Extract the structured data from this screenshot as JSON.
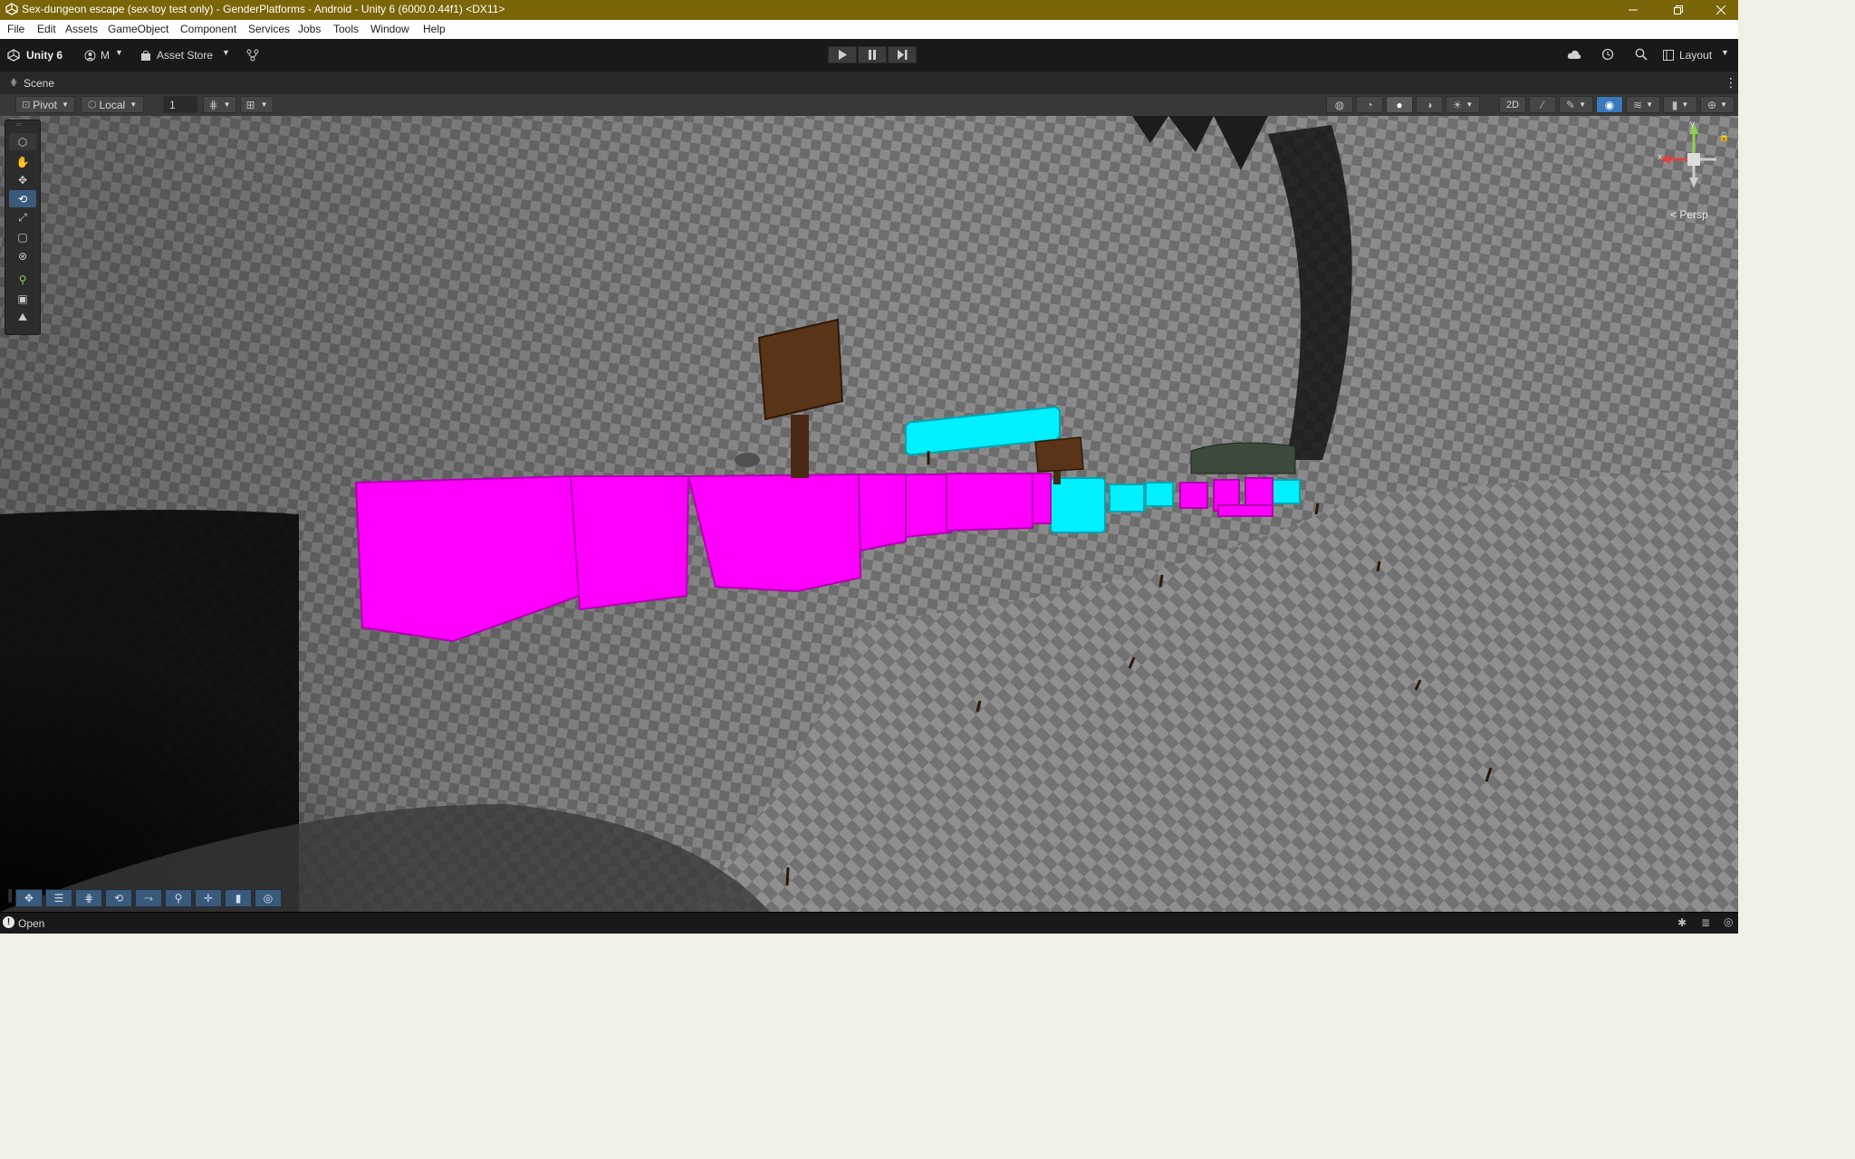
{
  "window": {
    "title": "Sex-dungeon escape (sex-toy test only) - GenderPlatforms - Android - Unity 6 (6000.0.44f1) <DX11>",
    "titlebar_color": "#7b6509",
    "controls": {
      "minimize": "minimize-icon",
      "maximize": "restore-icon",
      "close": "close-icon"
    }
  },
  "menu": [
    "File",
    "Edit",
    "Assets",
    "GameObject",
    "Component",
    "Services",
    "Jobs",
    "Tools",
    "Window",
    "Help"
  ],
  "toolbar": {
    "unity_label": "Unity 6",
    "account_label": "M",
    "asset_store_label": "Asset Store",
    "layout_label": "Layout",
    "play_icons": [
      "play-icon",
      "pause-icon",
      "step-icon"
    ]
  },
  "scene_tab": {
    "label": "Scene"
  },
  "scene_toolbar": {
    "pivot_label": "Pivot",
    "space_label": "Local",
    "grid_value": "1",
    "mode_2d_label": "2D"
  },
  "gizmo": {
    "x_label": "x",
    "y_label": "y",
    "projection_label": "< Persp"
  },
  "status": {
    "text": "Open"
  },
  "colors": {
    "editor_background": "#191919",
    "magenta_platform": "#ff00ff",
    "cyan_platform": "#00f0ff",
    "signpost": "#4a2a14",
    "accent_blue": "#3a79bb"
  }
}
